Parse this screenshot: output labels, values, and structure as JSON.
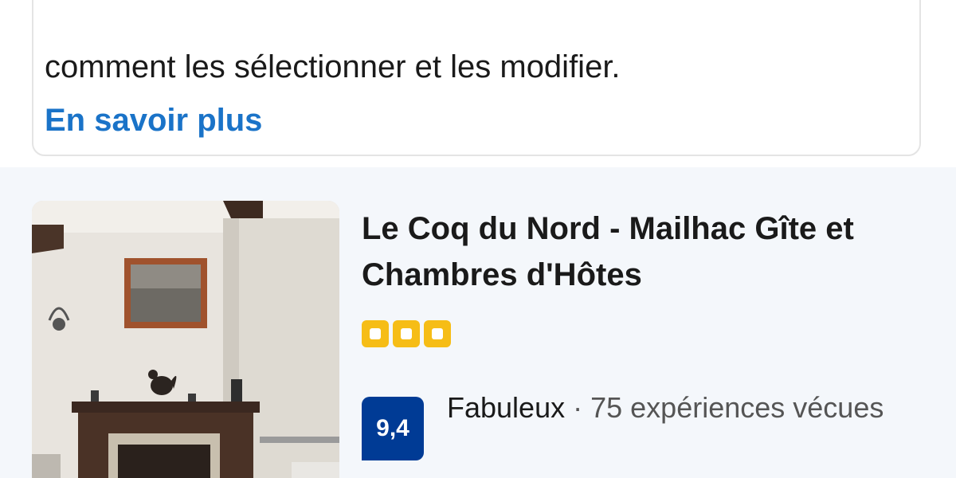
{
  "info_card": {
    "text": "comment les sélectionner et les modifier.",
    "link_label": "En savoir plus"
  },
  "listing": {
    "image_alt": "Le Coq du Nord - Mailhac Gîte et Chambres d'Hôtes photo",
    "name": "Le Coq du Nord - Mailhac Gîte et Chambres d'Hôtes",
    "star_rating": 3,
    "score": "9,4",
    "review_word": "Fabuleux",
    "separator": " · ",
    "review_count": "75 expériences vécues"
  },
  "colors": {
    "link": "#1a73c8",
    "star": "#f6bd16",
    "score_badge": "#003b95",
    "listing_bg": "#f4f7fb"
  }
}
